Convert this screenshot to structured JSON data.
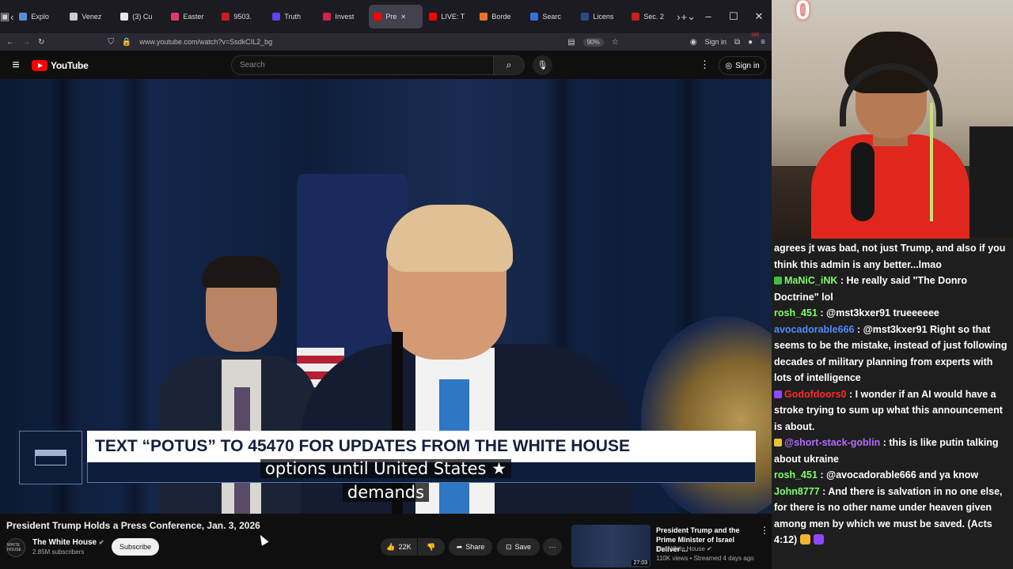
{
  "browser": {
    "tabs": [
      {
        "label": "Explo",
        "color": "#5b8dd6"
      },
      {
        "label": "Venez",
        "color": "#cccccc"
      },
      {
        "label": "(3) Cu",
        "color": "#e7e7e7"
      },
      {
        "label": "Easter",
        "color": "#e03a6a"
      },
      {
        "label": "9503.",
        "color": "#c81e1e"
      },
      {
        "label": "Truth",
        "color": "#5448ee"
      },
      {
        "label": "Invest",
        "color": "#d6204e"
      },
      {
        "label": "Pre",
        "color": "#ff0000",
        "active": true
      },
      {
        "label": "LIVE: T",
        "color": "#ff0000"
      },
      {
        "label": "Borde",
        "color": "#e8742a"
      },
      {
        "label": "Searc",
        "color": "#3a6fd8"
      },
      {
        "label": "Licens",
        "color": "#2b4a8a"
      },
      {
        "label": "Sec. 2",
        "color": "#c81e1e"
      }
    ],
    "url": "www.youtube.com/watch?v=SsdkCIL2_bg",
    "zoom": "90%",
    "sign_in": "Sign in",
    "notifications_count": "385"
  },
  "youtube": {
    "logo_text": "YouTube",
    "search_placeholder": "Search",
    "sign_in": "Sign in",
    "video": {
      "lower_third": "TEXT “POTUS” TO 45470 FOR UPDATES FROM THE WHITE HOUSE",
      "caption_line1": "options until United States ★",
      "caption_line2": "demands"
    },
    "title": "President Trump Holds a Press Conference, Jan. 3, 2026",
    "channel": {
      "avatar_text": "WHITE HOUSE",
      "name": "The White House",
      "subscribers": "2.85M subscribers"
    },
    "subscribe_label": "Subscribe",
    "likes": "22K",
    "share_label": "Share",
    "save_label": "Save",
    "recommended": {
      "title": "President Trump and the Prime Minister of Israel Deliver ...",
      "channel": "The White House",
      "meta": "110K views • Streamed 4 days ago",
      "duration": "27:03"
    }
  },
  "webcam": {
    "counter": "0"
  },
  "chat": [
    {
      "user": "",
      "text": "agrees jt was bad, not just Trump, and also if you think this admin is any better...lmao",
      "color": "#ffffff"
    },
    {
      "user": "MaNiC_iNK",
      "text": "He really said \"The Donro Doctrine\" lol",
      "color": "#7dff6b",
      "badge": "#3fbf3f"
    },
    {
      "user": "rosh_451",
      "text": "@mst3kxer91 trueeeeee",
      "color": "#7dff6b"
    },
    {
      "user": "avocadorable666",
      "text": "@mst3kxer91 Right so that seems to be the mistake, instead of just following decades of military planning from experts with lots of intelligence",
      "color": "#4f8cff"
    },
    {
      "user": "Godofdoors0",
      "text": "I wonder if an AI would have a stroke trying to sum up what this announcement is about.",
      "color": "#ff2a2a",
      "badge": "#9147ff"
    },
    {
      "user": "@short-stack-goblin",
      "text": "this is like putin talking about ukraine",
      "color": "#b36bff",
      "badge": "#e8c23a"
    },
    {
      "user": "rosh_451",
      "text": "@avocadorable666 and ya know",
      "color": "#7dff6b"
    },
    {
      "user": "John8777",
      "text": "And there is salvation in no one else, for there is no other name under heaven given among men by which we must be saved. (Acts 4:12)",
      "color": "#7dff6b"
    }
  ]
}
